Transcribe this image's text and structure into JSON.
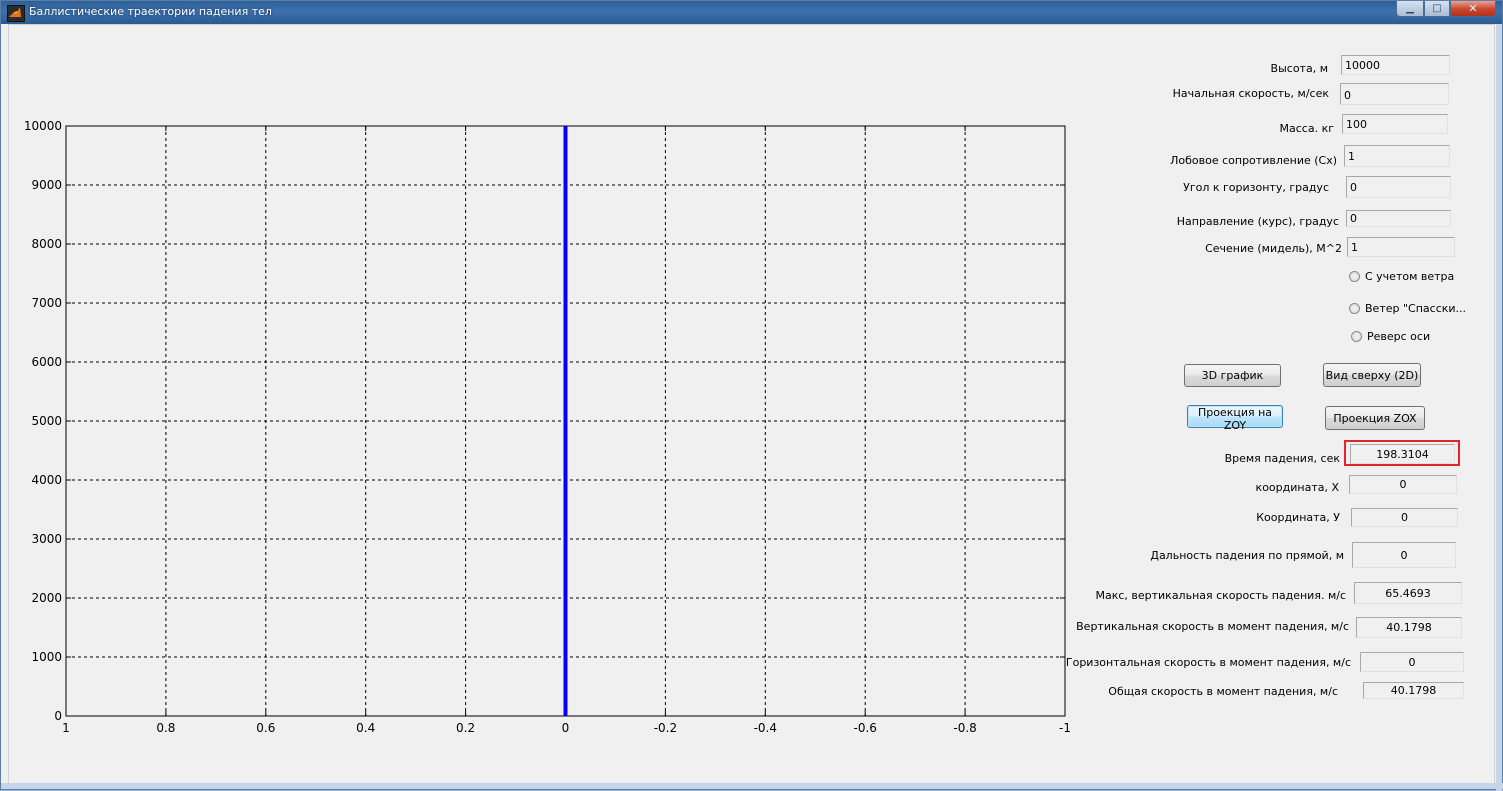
{
  "window": {
    "title": "Баллистические траектории падения тел",
    "min_glyph": "▁",
    "max_glyph": "□",
    "close_glyph": "✕"
  },
  "params": [
    {
      "label": "Высота, м",
      "value": "10000"
    },
    {
      "label": "Начальная скорость, м/сек",
      "value": "0"
    },
    {
      "label": "Масса. кг",
      "value": "100"
    },
    {
      "label": "Лобовое сопротивление (Сх)",
      "value": "1"
    },
    {
      "label": "Угол к горизонту, градус",
      "value": "0"
    },
    {
      "label": "Направление  (курс), градус",
      "value": "0"
    },
    {
      "label": "Сечение (мидель), М^2",
      "value": "1"
    }
  ],
  "options": [
    {
      "label": "С учетом ветра",
      "checked": false
    },
    {
      "label": "Ветер \"Спасски...",
      "checked": false
    },
    {
      "label": "Реверс оси",
      "checked": false
    }
  ],
  "buttons": {
    "plot_3d": "3D график",
    "top_view": "Вид сверху (2D)",
    "proj_zoy": "Проекция на ZOY",
    "proj_zox": "Проекция ZOX"
  },
  "results": [
    {
      "label": "Время падения, сек",
      "value": "198.3104"
    },
    {
      "label": "координата, Х",
      "value": "0"
    },
    {
      "label": "Координата, У",
      "value": "0"
    },
    {
      "label": "Дальность падения по прямой, м",
      "value": "0"
    },
    {
      "label": "Макс,  вертикальная скорость падения. м/с",
      "value": "65.4693"
    },
    {
      "label": "Вертикальная  скорость в момент падения, м/с",
      "value": "40.1798"
    },
    {
      "label": "Горизонтальная скорость в момент падения, м/с",
      "value": "0"
    },
    {
      "label": "Общая скорость в момент падения, м/с",
      "value": "40.1798"
    }
  ],
  "colors": {
    "trajectory": "#0000ff",
    "highlight": "#e0262a"
  },
  "chart_data": {
    "type": "line",
    "title": "",
    "xlabel": "",
    "ylabel": "",
    "xlim": [
      1,
      -1
    ],
    "ylim": [
      0,
      10000
    ],
    "x_reversed": true,
    "grid": true,
    "x_ticks": [
      1,
      0.8,
      0.6,
      0.4,
      0.2,
      0,
      -0.2,
      -0.4,
      -0.6,
      -0.8,
      -1
    ],
    "x_tick_labels": [
      "1",
      "0.8",
      "0.6",
      "0.4",
      "0.2",
      "0",
      "-0.2",
      "-0.4",
      "-0.6",
      "-0.8",
      "-1"
    ],
    "y_ticks": [
      0,
      1000,
      2000,
      3000,
      4000,
      5000,
      6000,
      7000,
      8000,
      9000,
      10000
    ],
    "y_tick_labels": [
      "0",
      "1000",
      "2000",
      "3000",
      "4000",
      "5000",
      "6000",
      "7000",
      "8000",
      "9000",
      "10000"
    ],
    "series": [
      {
        "x": [
          0,
          0
        ],
        "y": [
          0,
          10000
        ],
        "color": "#0000ff"
      }
    ]
  }
}
